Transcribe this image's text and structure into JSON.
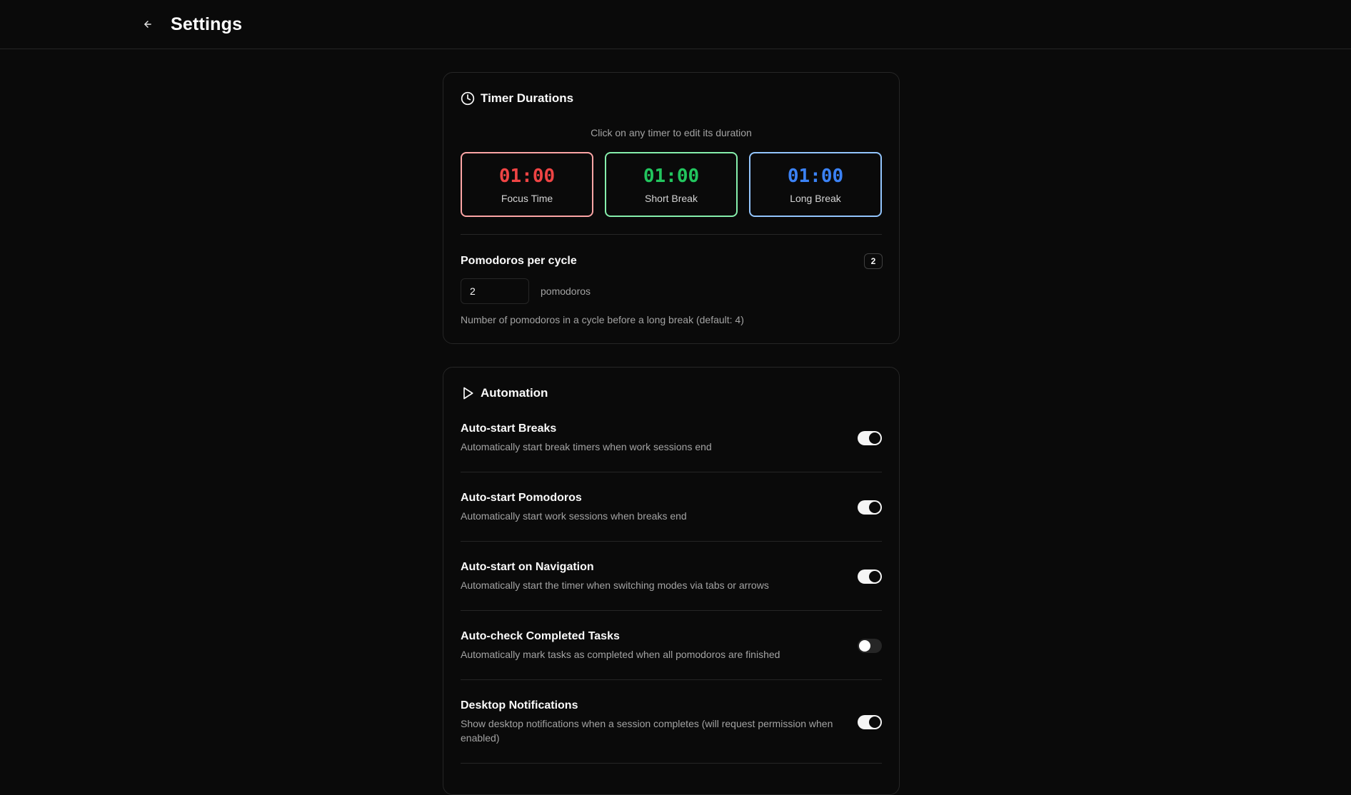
{
  "header": {
    "back_icon": "arrow-left-icon",
    "title": "Settings"
  },
  "timers_card": {
    "icon": "clock-icon",
    "title": "Timer Durations",
    "hint": "Click on any timer to edit its duration",
    "timers": [
      {
        "time": "01:00",
        "label": "Focus Time",
        "color": "#ef4444"
      },
      {
        "time": "01:00",
        "label": "Short Break",
        "color": "#22c55e"
      },
      {
        "time": "01:00",
        "label": "Long Break",
        "color": "#3b82f6"
      }
    ],
    "pomodoros": {
      "label": "Pomodoros per cycle",
      "badge": "2",
      "value": "2",
      "unit": "pomodoros",
      "help": "Number of pomodoros in a cycle before a long break (default: 4)"
    }
  },
  "automation_card": {
    "icon": "play-icon",
    "title": "Automation",
    "settings": [
      {
        "title": "Auto-start Breaks",
        "desc": "Automatically start break timers when work sessions end",
        "enabled": true
      },
      {
        "title": "Auto-start Pomodoros",
        "desc": "Automatically start work sessions when breaks end",
        "enabled": true
      },
      {
        "title": "Auto-start on Navigation",
        "desc": "Automatically start the timer when switching modes via tabs or arrows",
        "enabled": true
      },
      {
        "title": "Auto-check Completed Tasks",
        "desc": "Automatically mark tasks as completed when all pomodoros are finished",
        "enabled": false
      },
      {
        "title": "Desktop Notifications",
        "desc": "Show desktop notifications when a session completes (will request permission when enabled)",
        "enabled": true
      }
    ]
  }
}
